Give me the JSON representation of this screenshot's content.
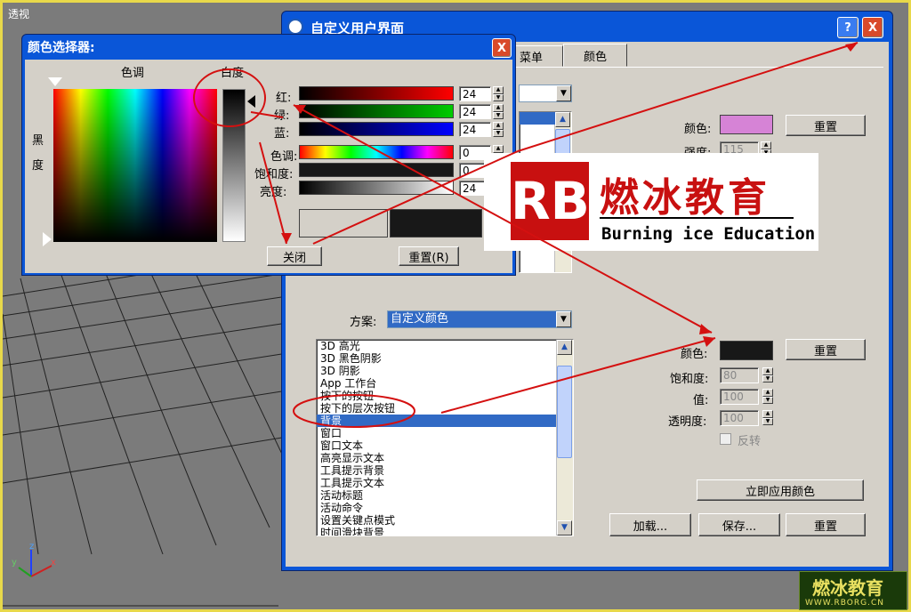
{
  "viewport": {
    "label": "透视"
  },
  "main_window": {
    "title": "自定义用户界面",
    "help_icon": "?",
    "close_icon": "X",
    "tabs": [
      "菜单",
      "颜色"
    ],
    "elements_combo": "",
    "color_label": "颜色:",
    "color_swatch": "#d683d6",
    "reset_label": "重置",
    "intensity_label": "强度:",
    "intensity_value": "115",
    "scheme_label": "方案:",
    "scheme_value": "自定义颜色",
    "items": [
      "3D 高光",
      "3D 黑色阴影",
      "3D 阴影",
      "App 工作台",
      "按下的按钮",
      "按下的层次按钮",
      "背景",
      "窗口",
      "窗口文本",
      "高亮显示文本",
      "工具提示背景",
      "工具提示文本",
      "活动标题",
      "活动命令",
      "设置关键点模式",
      "时间滑块背景"
    ],
    "selected_item": "背景",
    "color2_label": "颜色:",
    "color2_swatch": "#181818",
    "reset2_label": "重置",
    "saturation_label": "饱和度:",
    "saturation_value": "80",
    "value_label": "值:",
    "value_value": "100",
    "transparency_label": "透明度:",
    "transparency_value": "100",
    "invert_label": "反转",
    "apply_label": "立即应用颜色",
    "load_label": "加载...",
    "save_label": "保存...",
    "reset3_label": "重置"
  },
  "color_picker": {
    "title": "颜色选择器:",
    "close_icon": "X",
    "hue_label": "色调",
    "whiteness_label": "白度",
    "black_label": "黑",
    "degree_label": "度",
    "red_label": "红:",
    "green_label": "绿:",
    "blue_label": "蓝:",
    "hue2_label": "色调:",
    "sat_label": "饱和度:",
    "bright_label": "亮度:",
    "red": "24",
    "green": "24",
    "blue": "24",
    "hue": "0",
    "sat": "0",
    "bright": "24",
    "close_label": "关闭",
    "reset_label": "重置(R)",
    "old_color": "#d4d0c8",
    "new_color": "#181818"
  },
  "logo": {
    "mark": "RB",
    "name": "燃冰教育",
    "english": "Burning ice Education"
  },
  "watermark": {
    "name": "燃冰教育",
    "url": "WWW.RBORG.CN"
  },
  "axes": {
    "x": "x",
    "y": "y",
    "z": "z"
  }
}
